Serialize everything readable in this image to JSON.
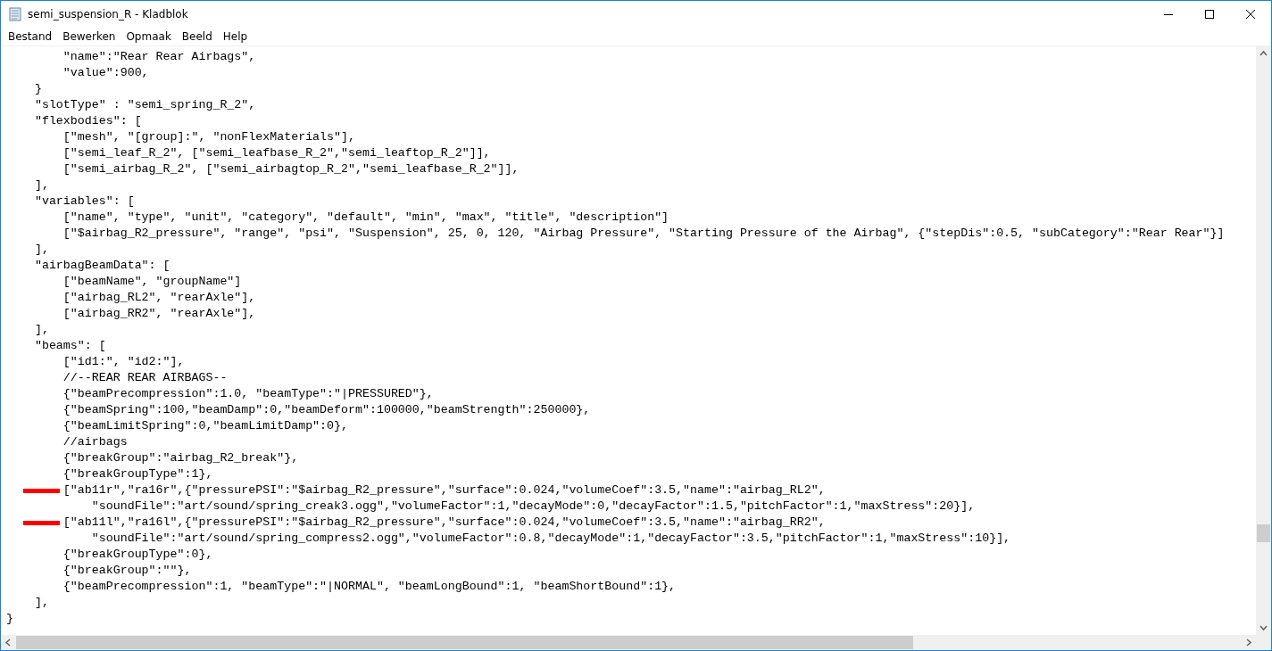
{
  "window": {
    "title": "semi_suspension_R - Kladblok"
  },
  "menu": [
    "Bestand",
    "Bewerken",
    "Opmaak",
    "Beeld",
    "Help"
  ],
  "lines": [
    {
      "text": "        \"name\":\"Rear Rear Airbags\",",
      "marked": false
    },
    {
      "text": "        \"value\":900,",
      "marked": false
    },
    {
      "text": "    }",
      "marked": false
    },
    {
      "text": "    \"slotType\" : \"semi_spring_R_2\",",
      "marked": false
    },
    {
      "text": "    \"flexbodies\": [",
      "marked": false
    },
    {
      "text": "        [\"mesh\", \"[group]:\", \"nonFlexMaterials\"],",
      "marked": false
    },
    {
      "text": "        [\"semi_leaf_R_2\", [\"semi_leafbase_R_2\",\"semi_leaftop_R_2\"]],",
      "marked": false
    },
    {
      "text": "        [\"semi_airbag_R_2\", [\"semi_airbagtop_R_2\",\"semi_leafbase_R_2\"]],",
      "marked": false
    },
    {
      "text": "    ],",
      "marked": false
    },
    {
      "text": "    \"variables\": [",
      "marked": false
    },
    {
      "text": "        [\"name\", \"type\", \"unit\", \"category\", \"default\", \"min\", \"max\", \"title\", \"description\"]",
      "marked": false
    },
    {
      "text": "        [\"$airbag_R2_pressure\", \"range\", \"psi\", \"Suspension\", 25, 0, 120, \"Airbag Pressure\", \"Starting Pressure of the Airbag\", {\"stepDis\":0.5, \"subCategory\":\"Rear Rear\"}]",
      "marked": false
    },
    {
      "text": "    ],",
      "marked": false
    },
    {
      "text": "    \"airbagBeamData\": [",
      "marked": false
    },
    {
      "text": "        [\"beamName\", \"groupName\"]",
      "marked": false
    },
    {
      "text": "        [\"airbag_RL2\", \"rearAxle\"],",
      "marked": false
    },
    {
      "text": "        [\"airbag_RR2\", \"rearAxle\"],",
      "marked": false
    },
    {
      "text": "    ],",
      "marked": false
    },
    {
      "text": "    \"beams\": [",
      "marked": false
    },
    {
      "text": "        [\"id1:\", \"id2:\"],",
      "marked": false
    },
    {
      "text": "        //--REAR REAR AIRBAGS--",
      "marked": false
    },
    {
      "text": "        {\"beamPrecompression\":1.0, \"beamType\":\"|PRESSURED\"},",
      "marked": false
    },
    {
      "text": "        {\"beamSpring\":100,\"beamDamp\":0,\"beamDeform\":100000,\"beamStrength\":250000},",
      "marked": false
    },
    {
      "text": "        {\"beamLimitSpring\":0,\"beamLimitDamp\":0},",
      "marked": false
    },
    {
      "text": "        //airbags",
      "marked": false
    },
    {
      "text": "        {\"breakGroup\":\"airbag_R2_break\"},",
      "marked": false
    },
    {
      "text": "        {\"breakGroupType\":1},",
      "marked": false
    },
    {
      "text": "        [\"ab11r\",\"ra16r\",{\"pressurePSI\":\"$airbag_R2_pressure\",\"surface\":0.024,\"volumeCoef\":3.5,\"name\":\"airbag_RL2\",",
      "marked": true
    },
    {
      "text": "            \"soundFile\":\"art/sound/spring_creak3.ogg\",\"volumeFactor\":1,\"decayMode\":0,\"decayFactor\":1.5,\"pitchFactor\":1,\"maxStress\":20}],",
      "marked": false
    },
    {
      "text": "        [\"ab11l\",\"ra16l\",{\"pressurePSI\":\"$airbag_R2_pressure\",\"surface\":0.024,\"volumeCoef\":3.5,\"name\":\"airbag_RR2\",",
      "marked": true
    },
    {
      "text": "            \"soundFile\":\"art/sound/spring_compress2.ogg\",\"volumeFactor\":0.8,\"decayMode\":1,\"decayFactor\":3.5,\"pitchFactor\":1,\"maxStress\":10}],",
      "marked": false
    },
    {
      "text": "        {\"breakGroupType\":0},",
      "marked": false
    },
    {
      "text": "        {\"breakGroup\":\"\"},",
      "marked": false
    },
    {
      "text": "        {\"beamPrecompression\":1, \"beamType\":\"|NORMAL\", \"beamLongBound\":1, \"beamShortBound\":1},",
      "marked": false
    },
    {
      "text": "    ],",
      "marked": false
    },
    {
      "text": "}",
      "marked": false
    }
  ]
}
